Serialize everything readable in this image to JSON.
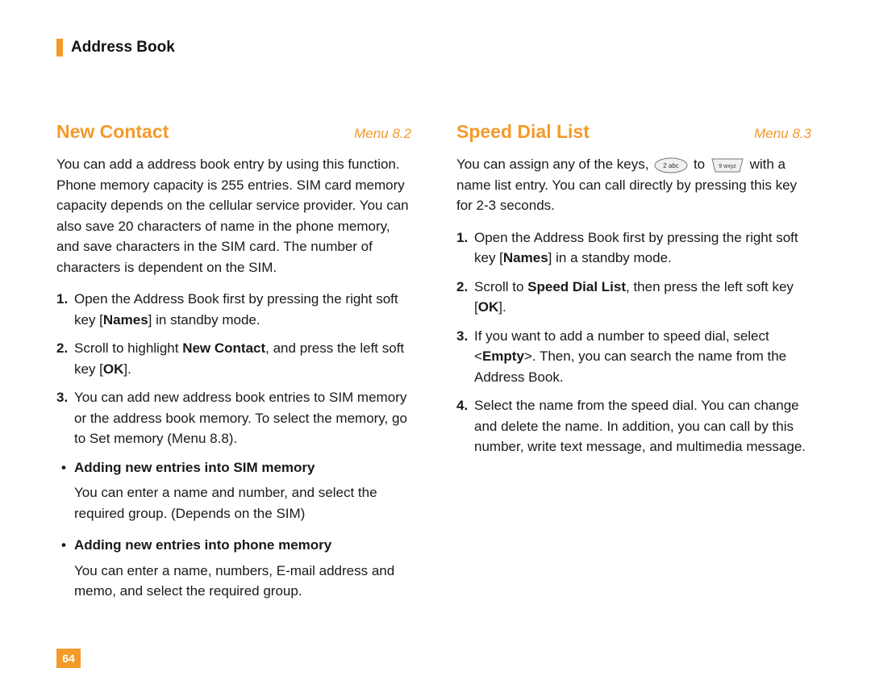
{
  "header": {
    "title": "Address Book"
  },
  "left": {
    "section_title": "New Contact",
    "menu": "Menu 8.2",
    "intro": "You can add a address book entry by using this function. Phone memory capacity is 255 entries. SIM card memory capacity depends on the cellular service provider. You can also save 20 characters of name in the phone memory, and save characters in the SIM card. The number of characters is dependent on the SIM.",
    "steps": {
      "s1_a": "Open the Address Book first by pressing the right soft key [",
      "s1_b": "Names",
      "s1_c": "] in standby mode.",
      "s2_a": "Scroll to highlight ",
      "s2_b": "New Contact",
      "s2_c": ", and press the left soft key [",
      "s2_d": "OK",
      "s2_e": "].",
      "s3": "You can add new address book entries to SIM memory or the address book memory. To select the memory, go to Set memory (Menu 8.8)."
    },
    "sub1_title": "Adding new entries into SIM memory",
    "sub1_text": "You can enter a name and number, and select the required group. (Depends on the SIM)",
    "sub2_title": "Adding new entries into phone memory",
    "sub2_text": "You can enter a name, numbers, E-mail address and memo, and select the required group."
  },
  "right": {
    "section_title": "Speed Dial List",
    "menu": "Menu 8.3",
    "intro_a": "You can assign any of the keys, ",
    "intro_to": " to ",
    "intro_b": " with a name list entry. You can call directly by pressing this key for 2-3 seconds.",
    "steps": {
      "s1_a": "Open the Address Book first by pressing the right soft key [",
      "s1_b": "Names",
      "s1_c": "] in a standby mode.",
      "s2_a": "Scroll to ",
      "s2_b": "Speed Dial List",
      "s2_c": ", then press the left soft key [",
      "s2_d": "OK",
      "s2_e": "].",
      "s3_a": "If you want to add a number to speed dial, select <",
      "s3_b": "Empty",
      "s3_c": ">. Then, you can search the name from the Address Book.",
      "s4": "Select the name from the speed dial. You can change and delete the name. In addition, you can call by this number, write text message, and multimedia message."
    }
  },
  "keys": {
    "two": "2abc",
    "nine": "9wxyz"
  },
  "page_number": "64",
  "nums": {
    "n1": "1.",
    "n2": "2.",
    "n3": "3.",
    "n4": "4."
  },
  "bullet": "•"
}
